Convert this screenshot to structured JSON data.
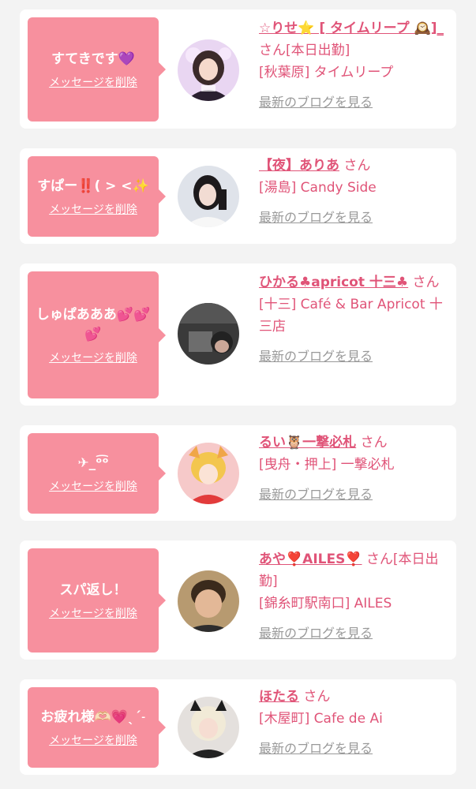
{
  "delete_label": "メッセージを削除",
  "blog_label": "最新のブログを見る",
  "san_label": "さん",
  "colors": {
    "bubble": "#f7909e",
    "accent": "#e05478",
    "link_gray": "#999999",
    "background": "#f3f3f3"
  },
  "items": [
    {
      "message": "すてきです💜",
      "name": "☆りせ⭐ [ タイムリープ 🕰️]_",
      "status": "[本日出勤]",
      "shop": "[秋葉原] タイムリープ",
      "avatar_icon": "girl-photo-icon"
    },
    {
      "message": "すぱー‼️( > <✨",
      "name": "【夜】ありあ",
      "status": "",
      "shop": "[湯島] Candy Side",
      "avatar_icon": "girl-photo-icon"
    },
    {
      "message": "しゅぱあああ💕💕💕",
      "name": "ひかる♣apricot 十三♣",
      "status": "",
      "shop": "[十三] Café & Bar Apricot 十三店",
      "avatar_icon": "girl-photo-icon"
    },
    {
      "message": "✈︎_ᵒ͡ᵒ",
      "name": "るい🦉一撃必札",
      "status": "",
      "shop": "[曳舟・押上] 一撃必札",
      "avatar_icon": "girl-photo-icon"
    },
    {
      "message": "スパ返し！",
      "name": "あや❣️AILES❣️",
      "status": "[本日出勤]",
      "shop": "[錦糸町駅南口] AILES",
      "avatar_icon": "girl-photo-icon"
    },
    {
      "message": "お疲れ様🫶🏻💗ˎˊ˗",
      "name": "ほたる",
      "status": "",
      "shop": "[木屋町] Cafe de Ai",
      "avatar_icon": "girl-photo-icon"
    }
  ]
}
